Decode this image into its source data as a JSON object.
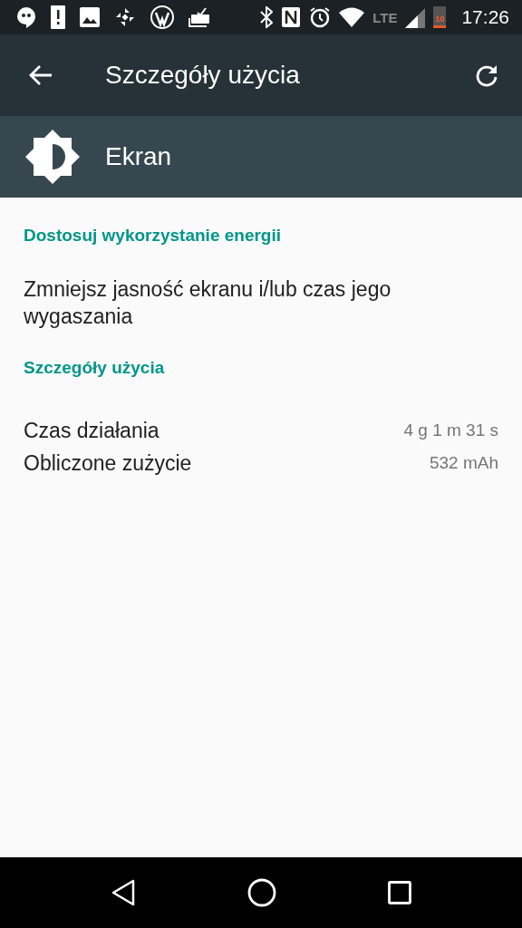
{
  "status_bar": {
    "network": "LTE",
    "battery": "10",
    "time": "17:26"
  },
  "toolbar": {
    "title": "Szczegóły użycia"
  },
  "header": {
    "title": "Ekran"
  },
  "sections": [
    {
      "heading": "Dostosuj wykorzystanie energii",
      "kind": "text",
      "text": "Zmniejsz jasność ekranu i/lub czas jego wygaszania"
    },
    {
      "heading": "Szczegóły użycia",
      "kind": "rows",
      "rows": [
        {
          "label": "Czas działania",
          "value": "4 g 1 m 31 s"
        },
        {
          "label": "Obliczone zużycie",
          "value": "532 mAh"
        }
      ]
    }
  ]
}
